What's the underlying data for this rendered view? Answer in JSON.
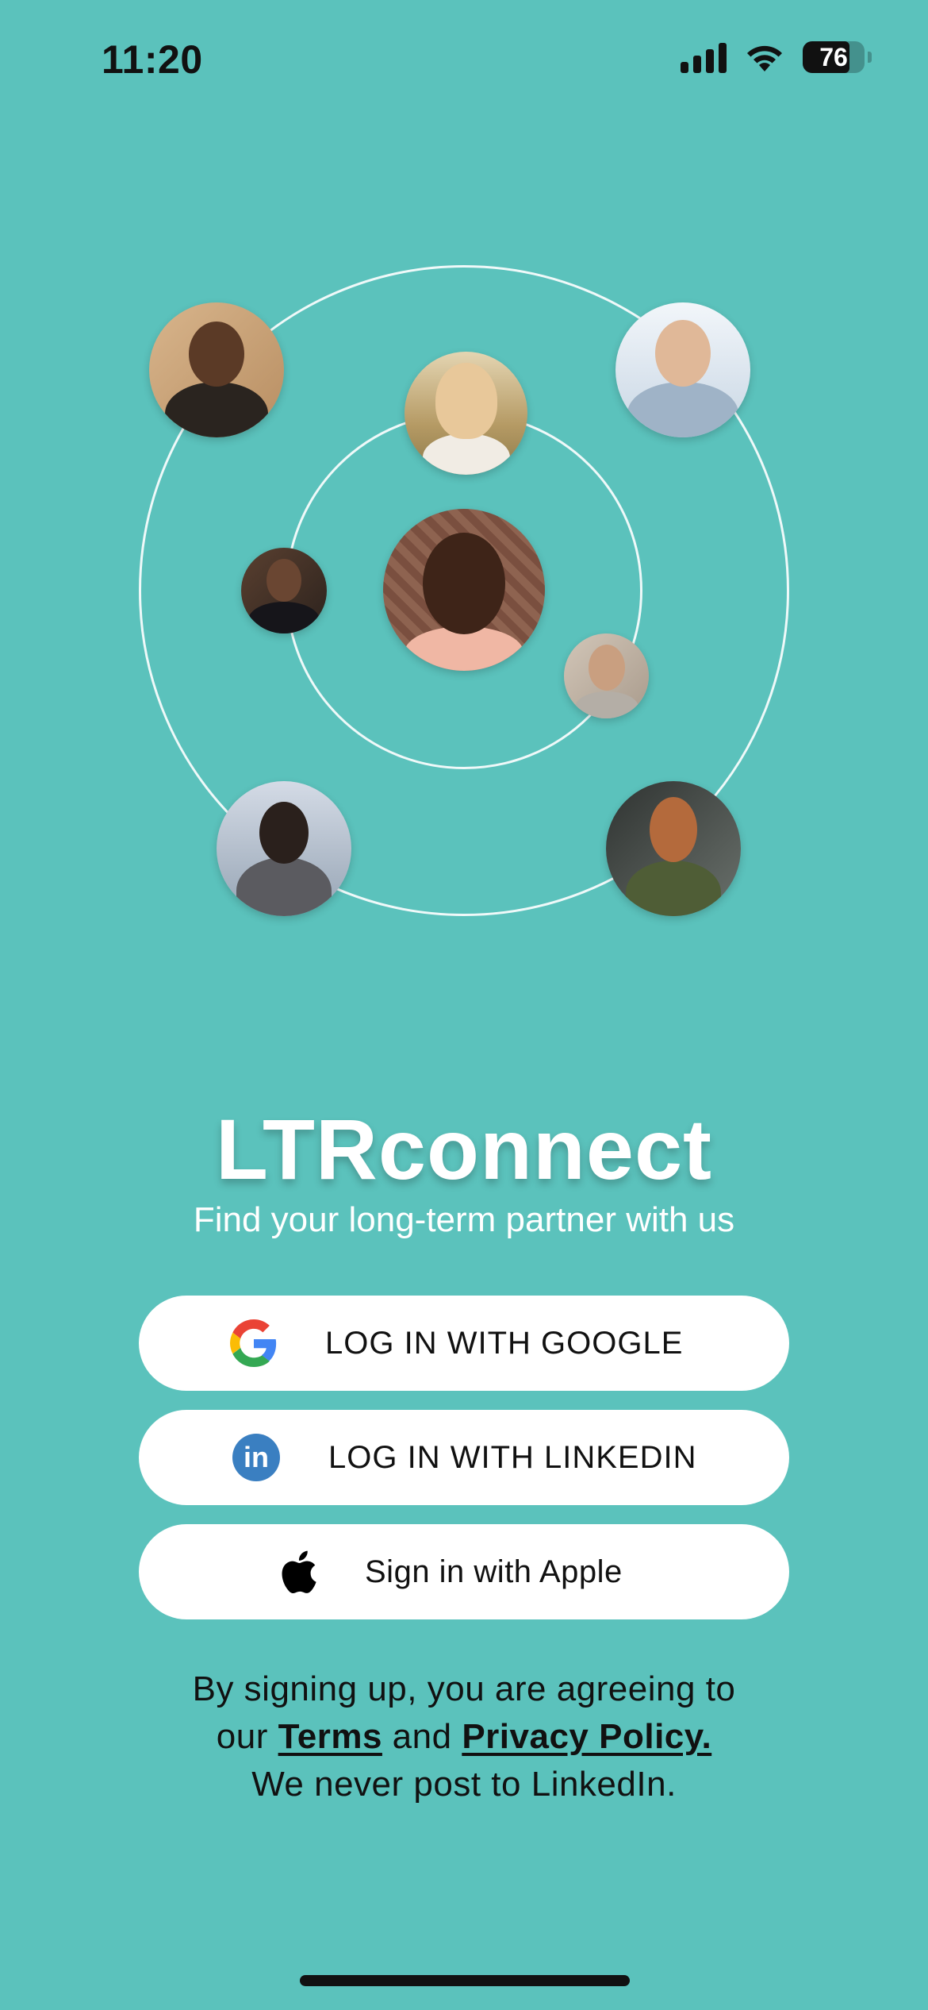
{
  "status_bar": {
    "time": "11:20",
    "battery_level": "76",
    "icons": [
      "signal-icon",
      "wifi-icon",
      "battery-icon"
    ]
  },
  "illustration": {
    "avatars": [
      {
        "name": "profile-photo-man-beard-dark",
        "colors": [
          "#c9a27a",
          "#2a241f"
        ]
      },
      {
        "name": "profile-photo-woman-blonde",
        "colors": [
          "#b79a6c",
          "#e8c89a"
        ]
      },
      {
        "name": "profile-photo-man-glasses-office",
        "colors": [
          "#d8e4ee",
          "#9db3c9"
        ]
      },
      {
        "name": "profile-photo-man-suit",
        "colors": [
          "#3b2d25",
          "#1c1a1c"
        ]
      },
      {
        "name": "profile-photo-woman-smiling-center",
        "colors": [
          "#8a5a48",
          "#4a2a22"
        ]
      },
      {
        "name": "profile-photo-man-thinking",
        "colors": [
          "#c7b8a8",
          "#6b4b3a"
        ]
      },
      {
        "name": "profile-photo-woman-city",
        "colors": [
          "#b9c5d2",
          "#5a5a5e"
        ]
      },
      {
        "name": "profile-photo-man-beard-outdoor",
        "colors": [
          "#4a4f4b",
          "#4f5a3a"
        ]
      }
    ]
  },
  "brand": {
    "title": "LTRconnect",
    "subtitle": "Find your long-term partner with us"
  },
  "buttons": {
    "google": "LOG IN WITH GOOGLE",
    "linkedin": "LOG IN WITH LINKEDIN",
    "apple": "Sign in with Apple",
    "linkedin_icon_text": "in"
  },
  "legal": {
    "line1": "By signing up, you are agreeing to",
    "prefix": "our",
    "terms_link": "Terms",
    "and": "and",
    "privacy_link": "Privacy Policy.",
    "line3": "We never post to LinkedIn."
  },
  "colors": {
    "background": "#5bc2bc",
    "button_bg": "#ffffff",
    "linkedin_blue": "#3a7fc1"
  }
}
